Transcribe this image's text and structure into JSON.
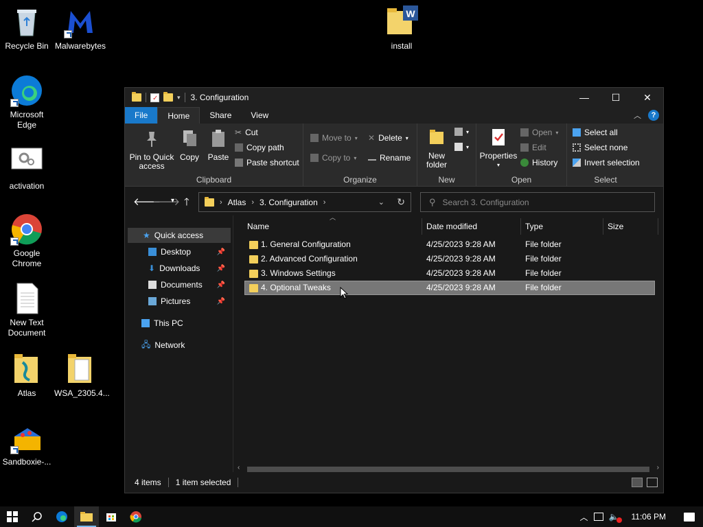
{
  "desktop": {
    "icons": [
      {
        "label": "Recycle Bin"
      },
      {
        "label": "Malwarebytes"
      },
      {
        "label": "install"
      },
      {
        "label": "Microsoft Edge"
      },
      {
        "label": "activation"
      },
      {
        "label": "Google Chrome"
      },
      {
        "label": "New Text Document"
      },
      {
        "label": "Atlas"
      },
      {
        "label": "WSA_2305.4..."
      },
      {
        "label": "Sandboxie-..."
      }
    ]
  },
  "window": {
    "title": "3. Configuration",
    "controls": {
      "minimize": "—",
      "maximize": "☐",
      "close": "✕"
    }
  },
  "tabs": {
    "file": "File",
    "home": "Home",
    "share": "Share",
    "view": "View",
    "help": "?"
  },
  "ribbon": {
    "clipboard": {
      "name": "Clipboard",
      "pin": [
        "Pin to Quick",
        "access"
      ],
      "copy": "Copy",
      "paste": "Paste",
      "cut": "Cut",
      "copy_path": "Copy path",
      "paste_shortcut": "Paste shortcut"
    },
    "organize": {
      "name": "Organize",
      "move_to": "Move to",
      "copy_to": "Copy to",
      "delete": "Delete",
      "rename": "Rename"
    },
    "new": {
      "name": "New",
      "new_folder": [
        "New",
        "folder"
      ]
    },
    "open": {
      "name": "Open",
      "properties": "Properties",
      "open": "Open",
      "edit": "Edit",
      "history": "History"
    },
    "select": {
      "name": "Select",
      "select_all": "Select all",
      "select_none": "Select none",
      "invert": "Invert selection"
    }
  },
  "address": {
    "crumbs": [
      "Atlas",
      "3. Configuration"
    ],
    "search_placeholder": "Search 3. Configuration"
  },
  "nav": {
    "quick_access": "Quick access",
    "items": [
      "Desktop",
      "Downloads",
      "Documents",
      "Pictures"
    ],
    "this_pc": "This PC",
    "network": "Network"
  },
  "columns": {
    "name": "Name",
    "date": "Date modified",
    "type": "Type",
    "size": "Size"
  },
  "files": [
    {
      "name": "1. General Configuration",
      "date": "4/25/2023 9:28 AM",
      "type": "File folder"
    },
    {
      "name": "2. Advanced Configuration",
      "date": "4/25/2023 9:28 AM",
      "type": "File folder"
    },
    {
      "name": "3. Windows Settings",
      "date": "4/25/2023 9:28 AM",
      "type": "File folder"
    },
    {
      "name": "4. Optional Tweaks",
      "date": "4/25/2023 9:28 AM",
      "type": "File folder"
    }
  ],
  "status": {
    "count": "4 items",
    "selected": "1 item selected"
  },
  "taskbar": {
    "time": "11:06 PM"
  },
  "colors": {
    "accent": "#1979ca",
    "folder": "#f3cf5b",
    "selected_row": "#777777"
  }
}
